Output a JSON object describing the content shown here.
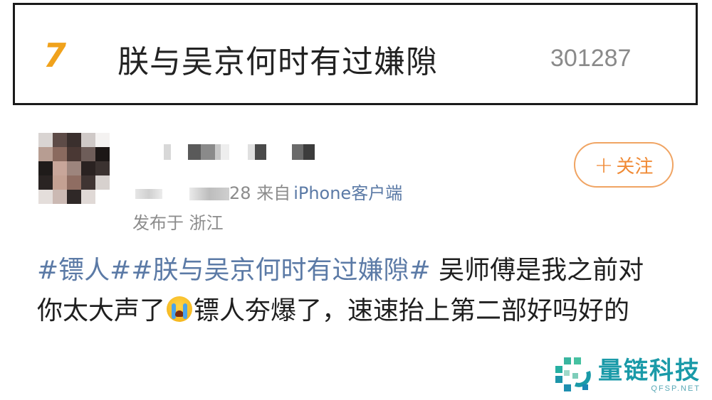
{
  "hot_search": {
    "rank": "7",
    "title": "朕与吴京何时有过嫌隙",
    "count": "301287"
  },
  "post": {
    "meta_fragment_date": "28",
    "source_prefix": "来自",
    "source_link": "iPhone客户端",
    "location": "发布于 浙江",
    "follow_label": "关注",
    "body_hashtag_1": "#镖人#",
    "body_hashtag_2": "#朕与吴京何时有过嫌隙#",
    "body_text_1": " 吴师傅是我之前对你太大声了",
    "body_text_2": "镖人夯爆了，速速抬上第二部好吗好的"
  },
  "watermark": {
    "brand": "量链科技",
    "domain": "QFSP.NET"
  },
  "colors": {
    "rank": "#f0a21c",
    "hashtag": "#5b7aa6",
    "follow": "#f08a35",
    "watermark": "#1a9aa8"
  },
  "icons": {
    "follow": "plus-icon",
    "emoji": "crying-face-emoji-icon",
    "logo": "qr-mark-icon"
  }
}
